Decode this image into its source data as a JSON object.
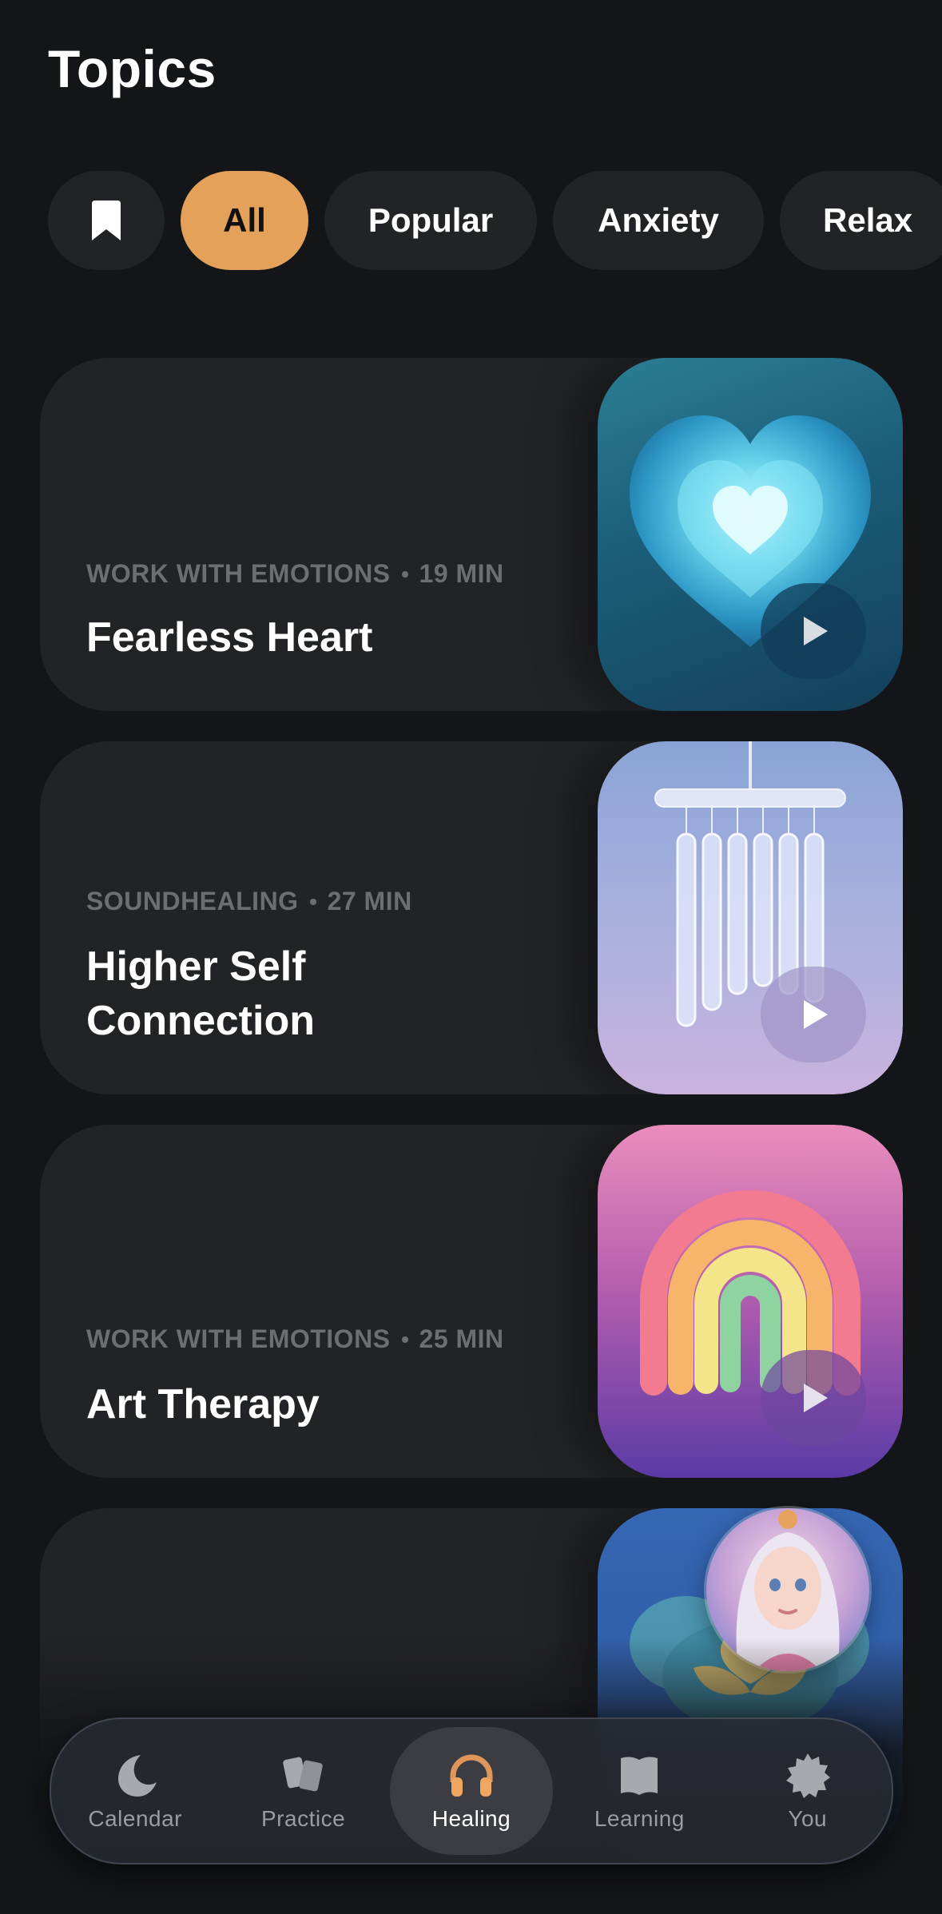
{
  "header": {
    "title": "Topics"
  },
  "filters": {
    "items": [
      "All",
      "Popular",
      "Anxiety",
      "Relax"
    ],
    "active": "All"
  },
  "cards": [
    {
      "category": "WORK WITH EMOTIONS",
      "duration": "19 MIN",
      "title": "Fearless Heart",
      "image": "glowing-heart"
    },
    {
      "category": "SOUNDHEALING",
      "duration": "27 MIN",
      "title": "Higher Self Connection",
      "image": "wind-chimes"
    },
    {
      "category": "WORK WITH EMOTIONS",
      "duration": "25 MIN",
      "title": "Art Therapy",
      "image": "rainbow"
    },
    {
      "category": "",
      "duration": "",
      "title": "",
      "image": "lotus-flower"
    }
  ],
  "nav": {
    "items": [
      {
        "label": "Calendar",
        "icon": "moon-icon"
      },
      {
        "label": "Practice",
        "icon": "cards-icon"
      },
      {
        "label": "Healing",
        "icon": "headphones-icon"
      },
      {
        "label": "Learning",
        "icon": "book-icon"
      },
      {
        "label": "You",
        "icon": "gear-icon"
      }
    ],
    "active": "Healing"
  },
  "colors": {
    "background": "#141518",
    "card": "#222326",
    "accent": "#e4a15a",
    "meta_text": "#6d6e72"
  }
}
